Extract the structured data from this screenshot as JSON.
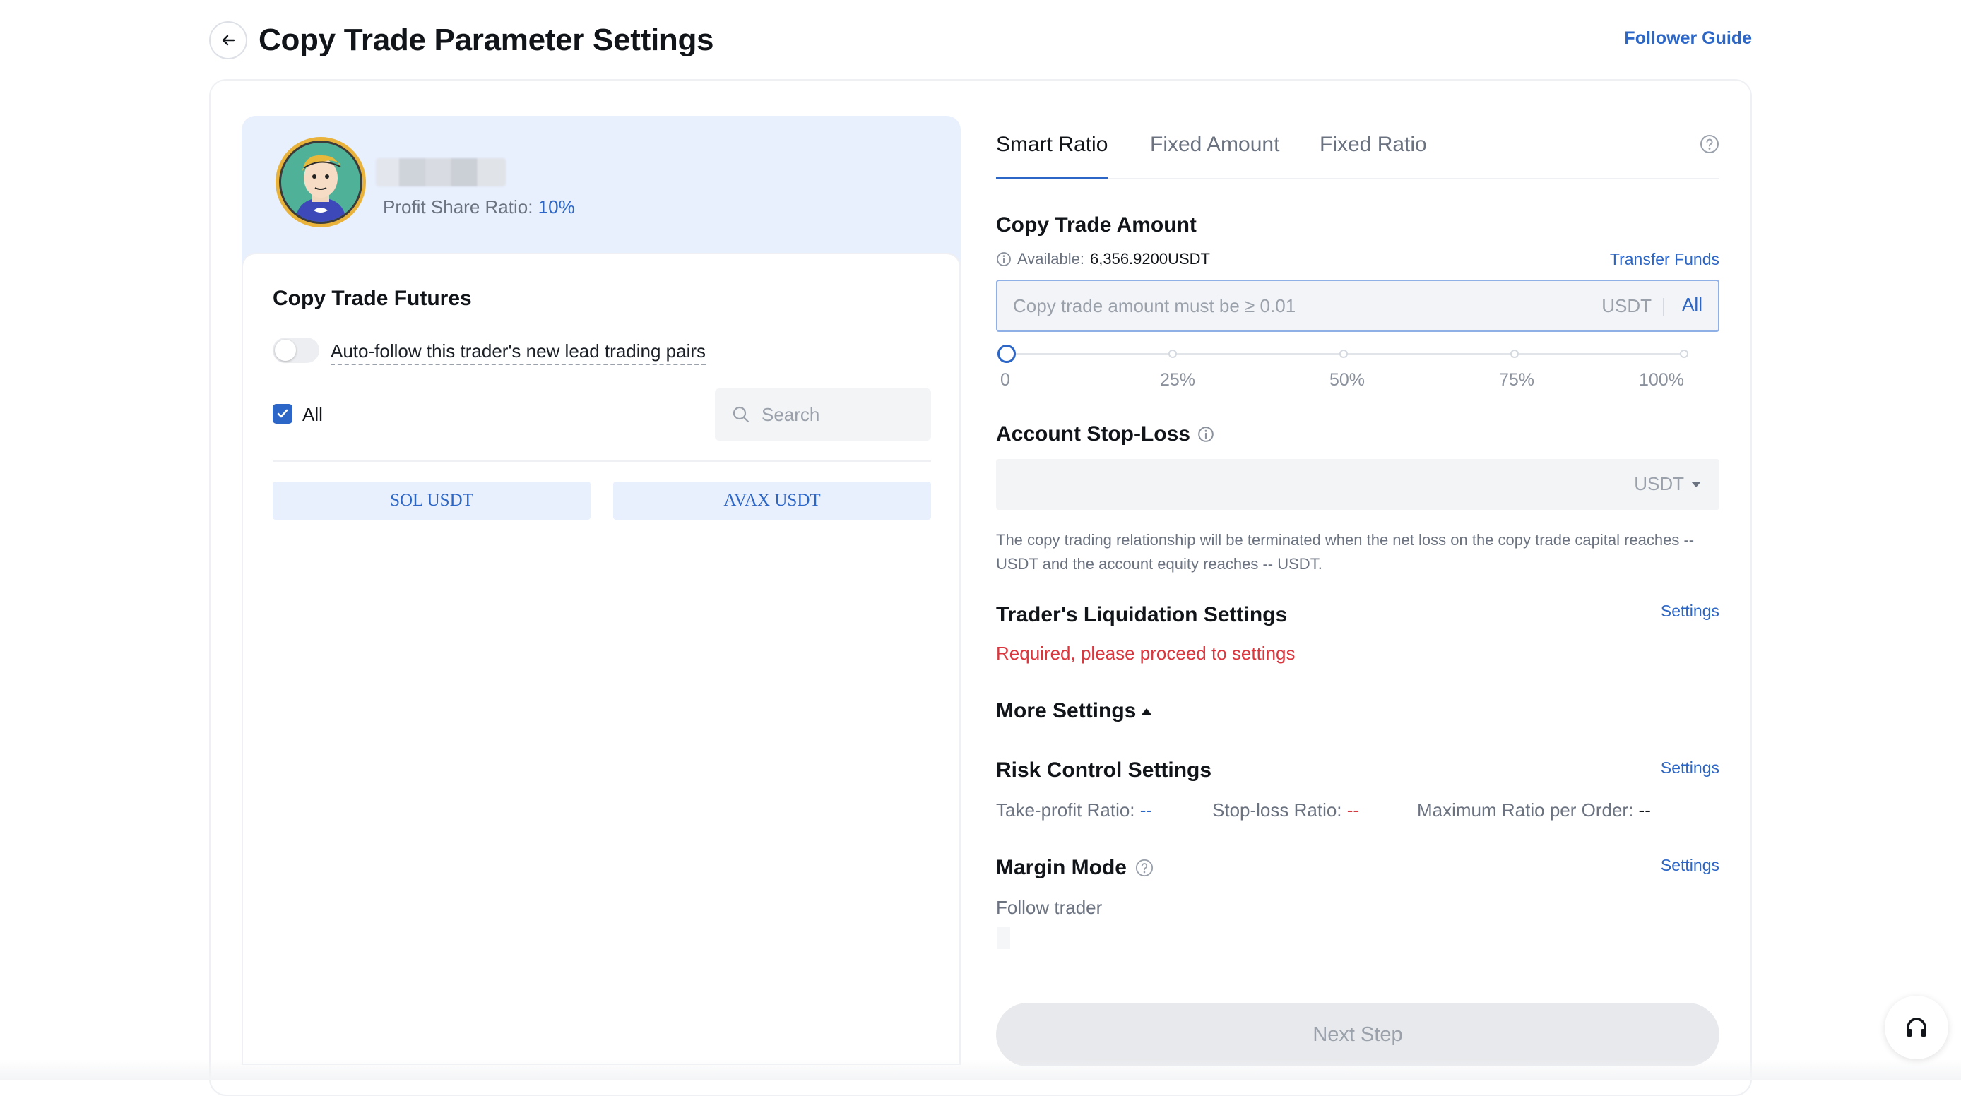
{
  "header": {
    "title": "Copy Trade Parameter Settings",
    "guide_link": "Follower Guide"
  },
  "trader": {
    "profit_share_label": "Profit Share Ratio:",
    "profit_share_value": "10%"
  },
  "futures": {
    "title": "Copy Trade Futures",
    "auto_follow_label": "Auto-follow this trader's new lead trading pairs",
    "auto_follow_enabled": false,
    "all_label": "All",
    "all_checked": true,
    "search_placeholder": "Search",
    "pairs": [
      "SOL USDT",
      "AVAX USDT"
    ]
  },
  "tabs": [
    {
      "label": "Smart Ratio",
      "active": true
    },
    {
      "label": "Fixed Amount",
      "active": false
    },
    {
      "label": "Fixed Ratio",
      "active": false
    }
  ],
  "copy_amount": {
    "title": "Copy Trade Amount",
    "available_label": "Available:",
    "available_value": "6,356.9200USDT",
    "transfer_link": "Transfer Funds",
    "placeholder": "Copy trade amount must be ≥ 0.01",
    "unit": "USDT",
    "all_button": "All",
    "slider_labels": [
      "0",
      "25%",
      "50%",
      "75%",
      "100%"
    ],
    "slider_value": 0
  },
  "stop_loss": {
    "title": "Account Stop-Loss",
    "unit": "USDT",
    "note": "The copy trading relationship will be terminated when the net loss on the copy trade capital reaches -- USDT and the account equity reaches -- USDT."
  },
  "liquidation": {
    "title": "Trader's Liquidation Settings",
    "settings_link": "Settings",
    "required_msg": "Required, please proceed to settings"
  },
  "more_settings": {
    "label": "More Settings"
  },
  "risk_control": {
    "title": "Risk Control Settings",
    "settings_link": "Settings",
    "take_profit_label": "Take-profit Ratio:",
    "take_profit_value": "--",
    "stop_loss_label": "Stop-loss Ratio:",
    "stop_loss_value": "--",
    "max_ratio_label": "Maximum Ratio per Order:",
    "max_ratio_value": "--"
  },
  "margin_mode": {
    "title": "Margin Mode",
    "settings_link": "Settings",
    "value": "Follow trader"
  },
  "next_button": "Next Step",
  "colors": {
    "accent": "#2c66c6",
    "danger": "#d9363e",
    "card_bg": "#e8effd"
  },
  "icons": [
    "back-arrow-icon",
    "search-icon",
    "check-icon",
    "info-icon",
    "help-icon",
    "headset-icon"
  ]
}
